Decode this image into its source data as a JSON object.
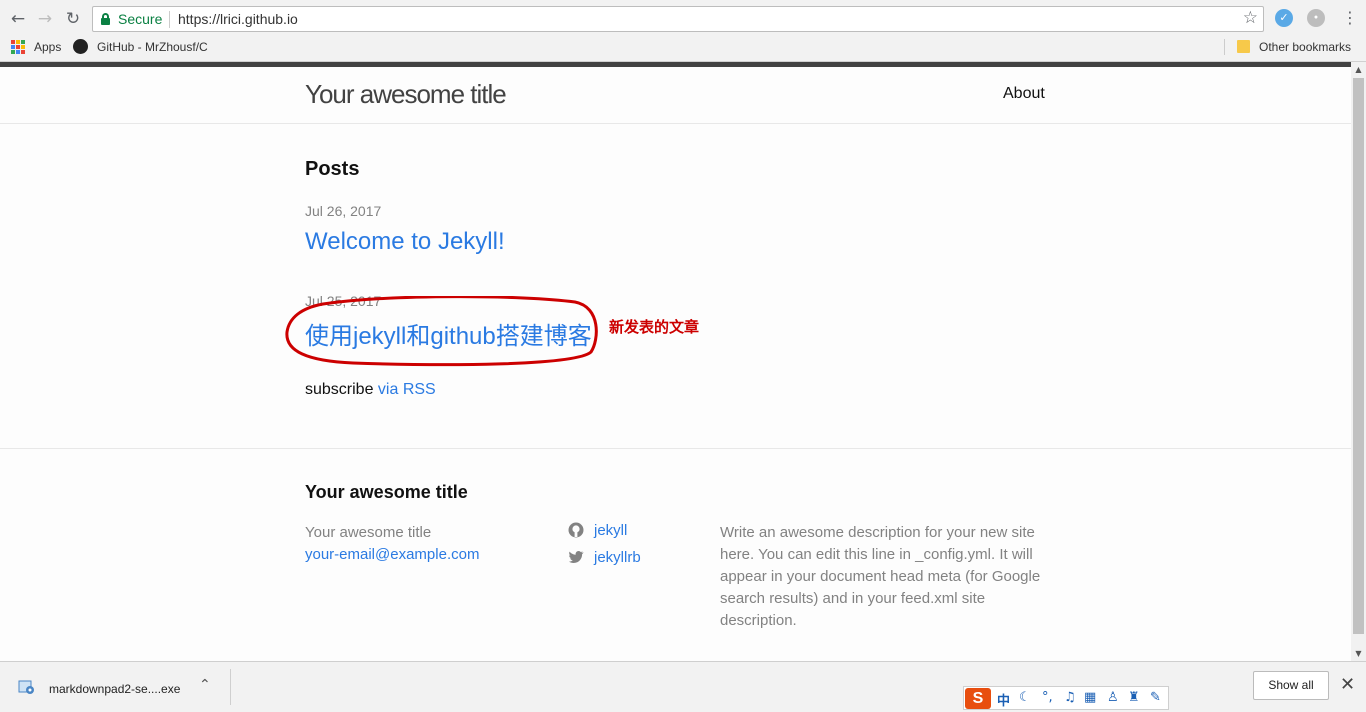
{
  "browser": {
    "security_label": "Secure",
    "url": "https://lrici.github.io",
    "bookmarks": [
      {
        "label": "Apps"
      },
      {
        "label": "GitHub - MrZhousf/C"
      }
    ],
    "other_bookmarks": "Other bookmarks"
  },
  "site": {
    "title": "Your awesome title",
    "nav": [
      {
        "label": "About"
      }
    ]
  },
  "main": {
    "heading": "Posts",
    "posts": [
      {
        "date": "Jul 26, 2017",
        "title": "Welcome to Jekyll!"
      },
      {
        "date": "Jul 25, 2017",
        "title": "使用jekyll和github搭建博客"
      }
    ],
    "subscribe_prefix": "subscribe ",
    "subscribe_link": "via RSS"
  },
  "annotation": {
    "text": "新发表的文章",
    "color": "#cc0000"
  },
  "footer": {
    "heading": "Your awesome title",
    "name": "Your awesome title",
    "email": "your-email@example.com",
    "github_user": "jekyll",
    "twitter_user": "jekyllrb",
    "description": "Write an awesome description for your new site here. You can edit this line in _config.yml. It will appear in your document head meta (for Google search results) and in your feed.xml site description."
  },
  "download_bar": {
    "filename": "markdownpad2-se....exe",
    "show_all": "Show all"
  },
  "ime": {
    "logo": "S",
    "mode": "中"
  },
  "colors": {
    "link": "#2a7ae2",
    "secure": "#0b8043",
    "muted": "#828282"
  }
}
